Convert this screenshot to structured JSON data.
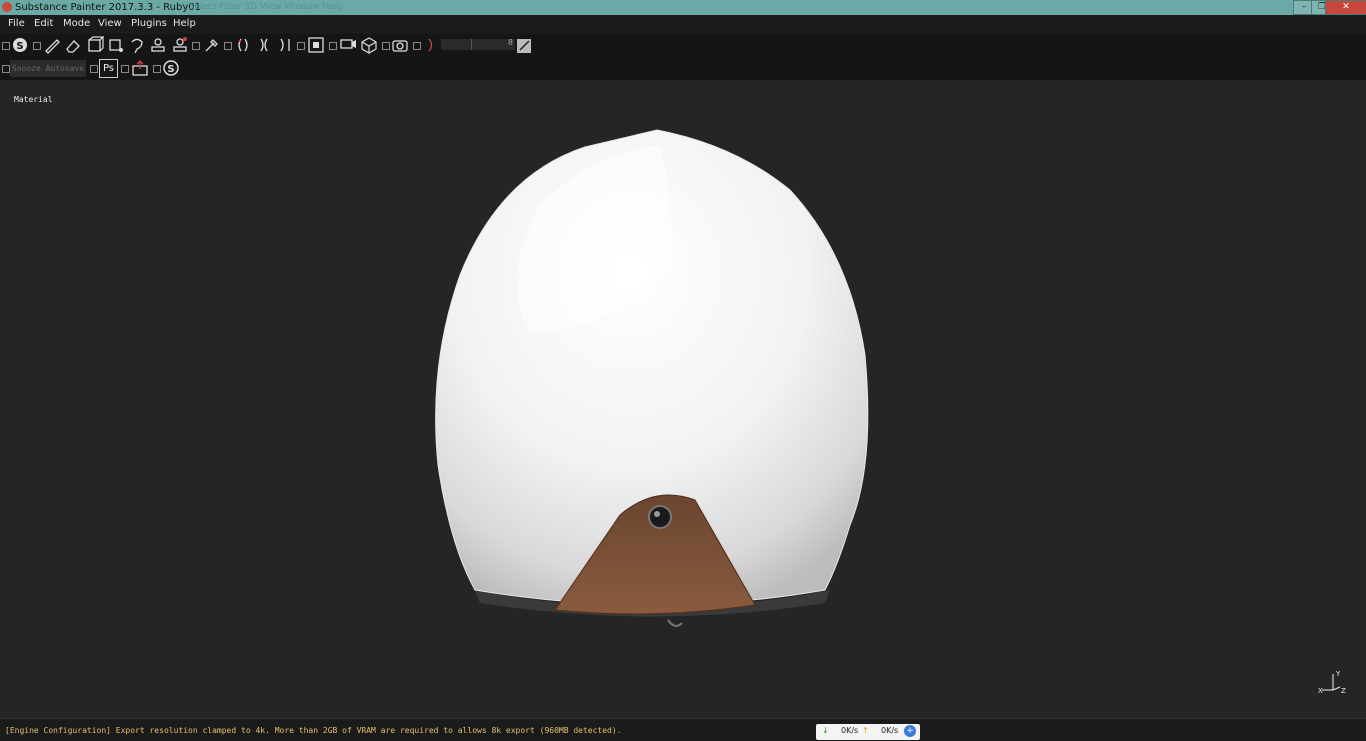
{
  "window": {
    "title": "Substance Painter 2017.3.3 - Ruby01",
    "ghost_menu": "...Select   Filter   3D   View   Window   Help"
  },
  "menubar": {
    "items": [
      "File",
      "Edit",
      "Mode",
      "View",
      "Plugins",
      "Help"
    ]
  },
  "toolbar": {
    "autosave_label": "Snooze Autosave",
    "photoshop_label": "Ps",
    "brush_size_value": "8"
  },
  "viewport": {
    "mode_label": "Material"
  },
  "axis": {
    "x": "X",
    "y": "Y",
    "z": "Z"
  },
  "statusbar": {
    "message": "[Engine Configuration] Export resolution clamped to 4k. More than 2GB of VRAM are required to allows 8k export (960MB detected).",
    "download_speed": "0K/s",
    "upload_speed": "0K/s"
  },
  "colors": {
    "accent": "#6aa9a6",
    "status_text": "#e0c16a",
    "viewport_bg": "#252528"
  }
}
